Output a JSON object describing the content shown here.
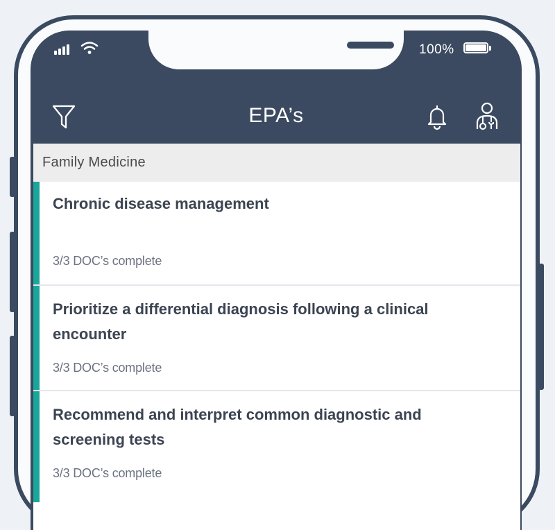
{
  "status_bar": {
    "battery_percent": "100%",
    "signal_icon": "signal-bars-icon",
    "wifi_icon": "wifi-icon",
    "battery_icon": "battery-icon"
  },
  "header": {
    "title": "EPA’s",
    "filter_icon": "filter-funnel-icon",
    "notification_icon": "bell-icon",
    "profile_icon": "doctor-profile-icon"
  },
  "section": {
    "label": "Family Medicine"
  },
  "items": [
    {
      "title": "Chronic disease management",
      "status": "3/3 DOC’s complete"
    },
    {
      "title": "Prioritize a differential diagnosis following a clinical encounter",
      "status": "3/3 DOC’s complete"
    },
    {
      "title": "Recommend and interpret common diagnostic and screening tests",
      "status": "3/3 DOC’s complete"
    }
  ],
  "colors": {
    "header_bg": "#3b4a60",
    "accent": "#1aa79a",
    "frame": "#3a4a61",
    "page_bg": "#eef1f6"
  }
}
